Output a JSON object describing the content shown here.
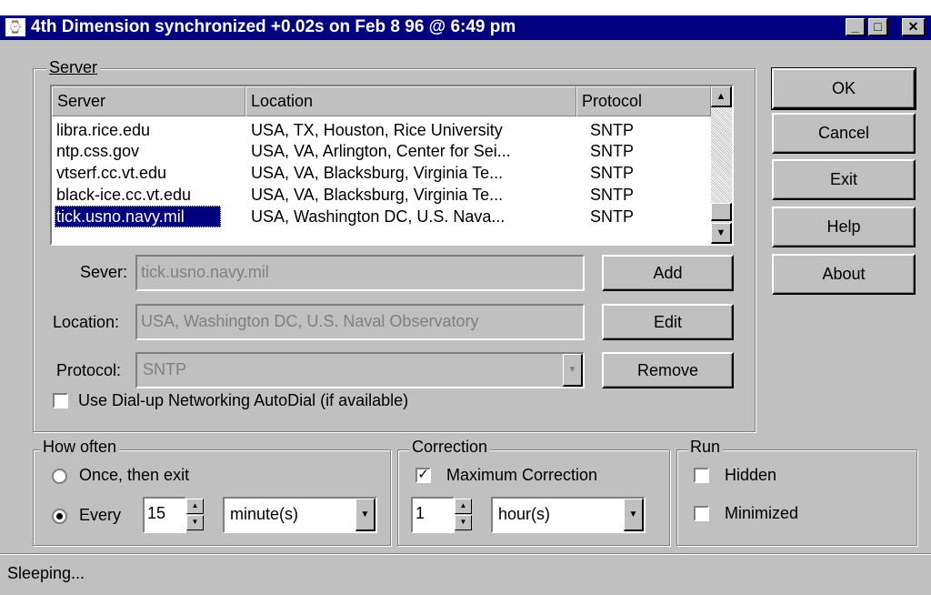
{
  "window": {
    "title": "4th Dimension synchronized +0.02s on Feb 8 96 @ 6:49 pm",
    "icon": "app-icon",
    "controls": [
      "minimize-icon",
      "maximize-icon",
      "close-icon"
    ]
  },
  "server_group": {
    "legend": "Server",
    "columns": [
      "Server",
      "Location",
      "Protocol"
    ],
    "rows": [
      {
        "server": "libra.rice.edu",
        "location": "USA, TX, Houston, Rice University",
        "protocol": "SNTP"
      },
      {
        "server": "ntp.css.gov",
        "location": "USA, VA, Arlington, Center for Sei...",
        "protocol": "SNTP"
      },
      {
        "server": "vtserf.cc.vt.edu",
        "location": "USA, VA, Blacksburg, Virginia Te...",
        "protocol": "SNTP"
      },
      {
        "server": "black-ice.cc.vt.edu",
        "location": "USA, VA, Blacksburg, Virginia Te...",
        "protocol": "SNTP"
      },
      {
        "server": "tick.usno.navy.mil",
        "location": "USA, Washington DC, U.S. Nava...",
        "protocol": "SNTP"
      }
    ],
    "server_label": "Sever:",
    "server_value": "tick.usno.navy.mil",
    "location_label": "Location:",
    "location_value": "USA, Washington DC, U.S. Naval Observatory",
    "protocol_label": "Protocol:",
    "protocol_value": "SNTP",
    "add_label": "Add",
    "edit_label": "Edit",
    "remove_label": "Remove",
    "autodial_label": "Use Dial-up Networking AutoDial (if available)",
    "autodial_checked": false
  },
  "buttons": {
    "ok": "OK",
    "cancel": "Cancel",
    "exit": "Exit",
    "help": "Help",
    "about": "About"
  },
  "how_often": {
    "legend": "How often",
    "once_label": "Once, then exit",
    "every_label": "Every",
    "every_value": "15",
    "unit_value": "minute(s)",
    "selected": "every"
  },
  "correction": {
    "legend": "Correction",
    "max_label": "Maximum Correction",
    "max_checked": true,
    "amount_value": "1",
    "unit_value": "hour(s)"
  },
  "run": {
    "legend": "Run",
    "hidden_label": "Hidden",
    "minimized_label": "Minimized"
  },
  "status": {
    "text": "Sleeping..."
  }
}
